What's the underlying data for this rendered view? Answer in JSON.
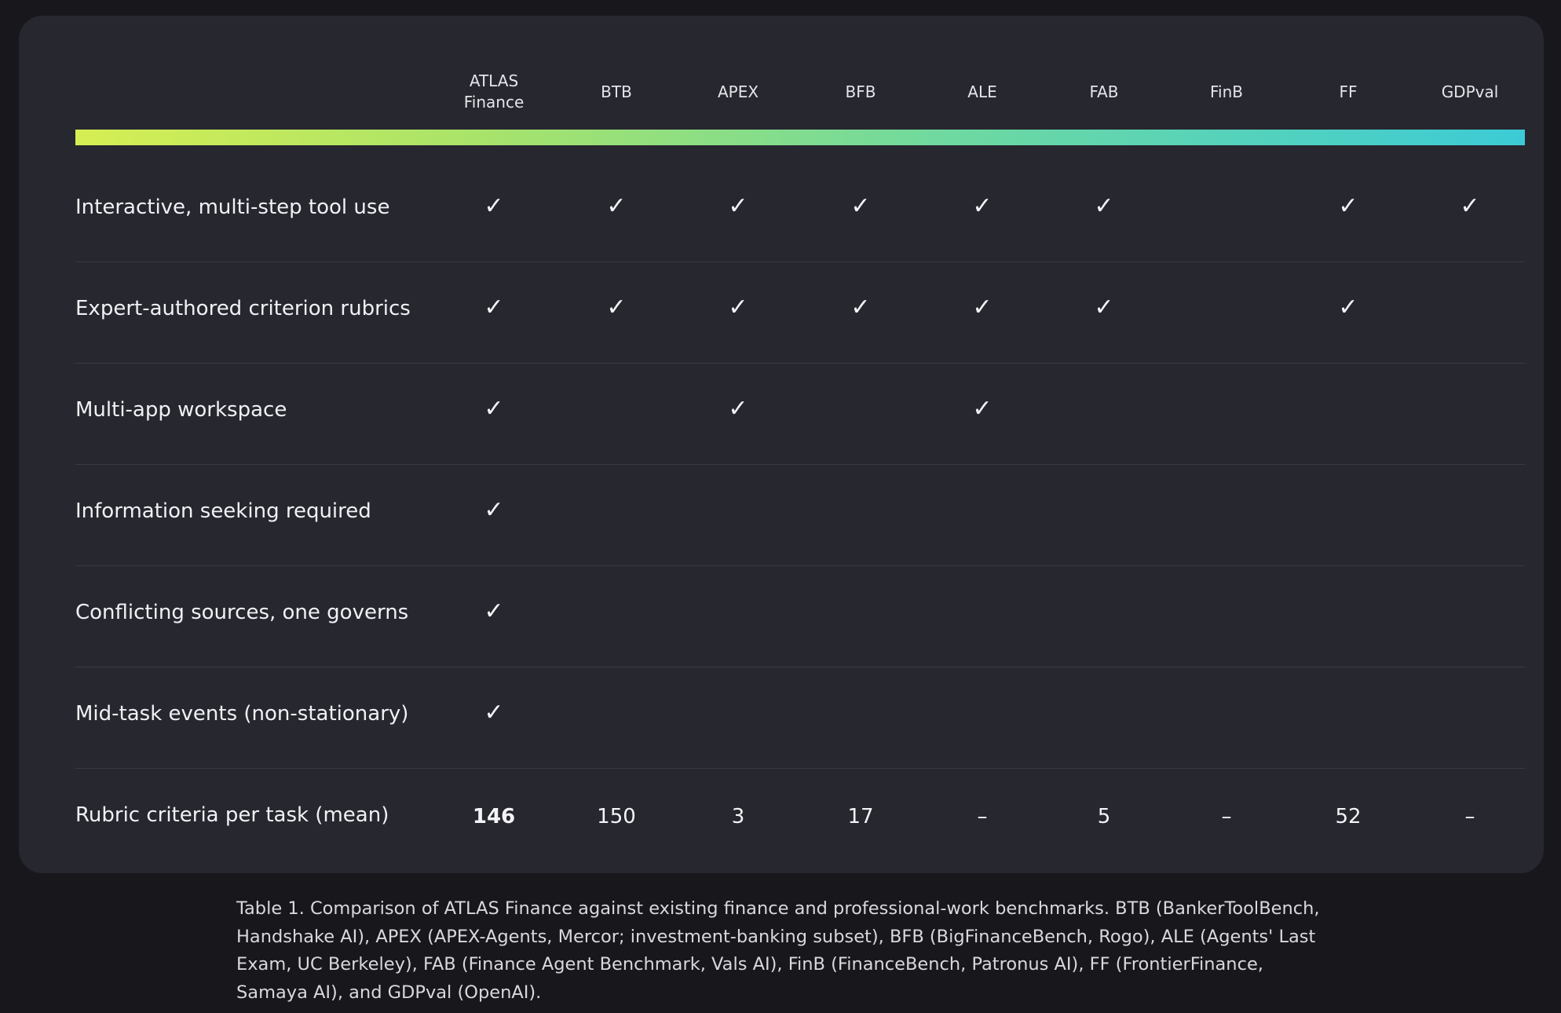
{
  "columns": [
    {
      "label": "ATLAS\nFinance"
    },
    {
      "label": "BTB"
    },
    {
      "label": "APEX"
    },
    {
      "label": "BFB"
    },
    {
      "label": "ALE"
    },
    {
      "label": "FAB"
    },
    {
      "label": "FinB"
    },
    {
      "label": "FF"
    },
    {
      "label": "GDPval"
    }
  ],
  "rows": [
    {
      "label": "Interactive, multi-step tool use",
      "cells": [
        "✓",
        "✓",
        "✓",
        "✓",
        "✓",
        "✓",
        "",
        "✓",
        "✓"
      ]
    },
    {
      "label": "Expert-authored criterion rubrics",
      "cells": [
        "✓",
        "✓",
        "✓",
        "✓",
        "✓",
        "✓",
        "",
        "✓",
        ""
      ]
    },
    {
      "label": "Multi-app workspace",
      "cells": [
        "✓",
        "",
        "✓",
        "",
        "✓",
        "",
        "",
        "",
        ""
      ]
    },
    {
      "label": "Information seeking required",
      "cells": [
        "✓",
        "",
        "",
        "",
        "",
        "",
        "",
        "",
        ""
      ]
    },
    {
      "label": "Conflicting sources, one governs",
      "cells": [
        "✓",
        "",
        "",
        "",
        "",
        "",
        "",
        "",
        ""
      ]
    },
    {
      "label": "Mid-task events (non-stationary)",
      "cells": [
        "✓",
        "",
        "",
        "",
        "",
        "",
        "",
        "",
        ""
      ]
    },
    {
      "label": "Rubric criteria per task (mean)",
      "cells": [
        "146",
        "150",
        "3",
        "17",
        "–",
        "5",
        "–",
        "52",
        "–"
      ]
    }
  ],
  "caption": "Table 1. Comparison of ATLAS Finance against existing finance and professional-work benchmarks. BTB (BankerToolBench, Handshake AI), APEX (APEX-Agents, Mercor; investment-banking subset), BFB (BigFinanceBench, Rogo), ALE (Agents' Last Exam, UC Berkeley), FAB (Finance Agent Benchmark, Vals AI), FinB (FinanceBench, Patronus AI), FF (FrontierFinance, Samaya AI), and GDPval (OpenAI)."
}
